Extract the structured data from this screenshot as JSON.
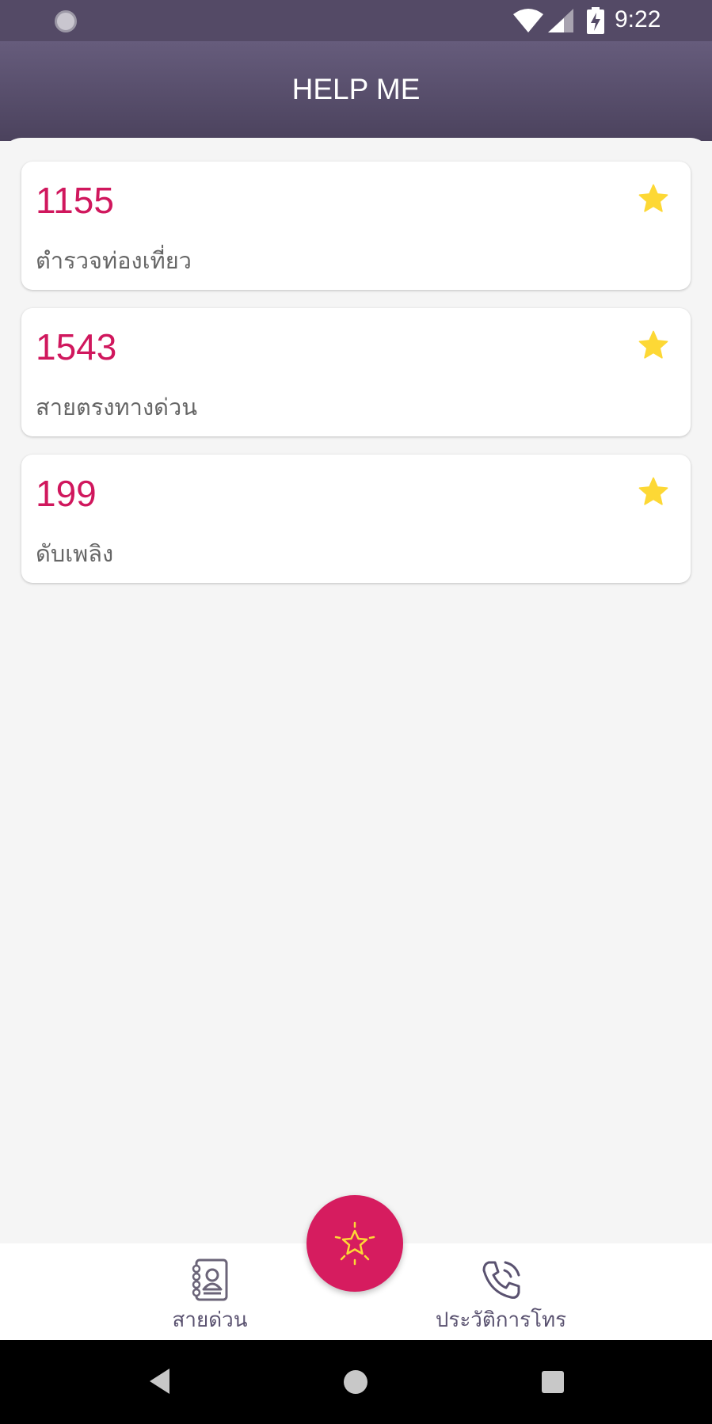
{
  "status_bar": {
    "time": "9:22"
  },
  "app_bar": {
    "title": "HELP ME"
  },
  "hotlines": [
    {
      "number": "1155",
      "label": "ตำรวจท่องเที่ยว"
    },
    {
      "number": "1543",
      "label": "สายตรงทางด่วน"
    },
    {
      "number": "199",
      "label": "ดับเพลิง"
    }
  ],
  "bottom_nav": {
    "hotline_label": "สายด่วน",
    "history_label": "ประวัติการโทร"
  },
  "colors": {
    "accent": "#d61c5f",
    "number_text": "#d0175d",
    "header": "#544a66",
    "star": "#fdd835"
  },
  "icons": {
    "status_left": "sync-icon",
    "wifi": "wifi-icon",
    "signal": "signal-icon",
    "battery": "battery-charging-icon",
    "card_star": "star-icon",
    "nav_hotline": "contact-book-icon",
    "nav_history": "phone-call-icon",
    "fab": "star-outline-icon",
    "sys_back": "back-icon",
    "sys_home": "home-icon",
    "sys_recents": "recents-icon"
  }
}
